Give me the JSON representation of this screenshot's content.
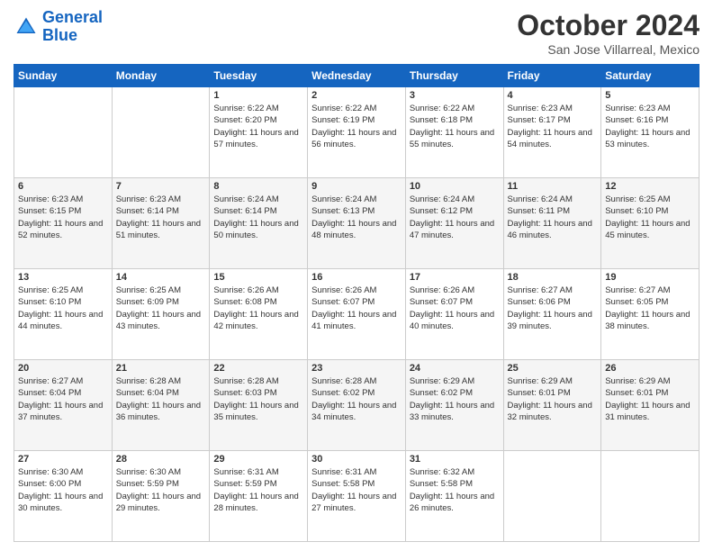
{
  "header": {
    "logo": {
      "line1": "General",
      "line2": "Blue"
    },
    "title": "October 2024",
    "location": "San Jose Villarreal, Mexico"
  },
  "days_of_week": [
    "Sunday",
    "Monday",
    "Tuesday",
    "Wednesday",
    "Thursday",
    "Friday",
    "Saturday"
  ],
  "weeks": [
    [
      {
        "day": "",
        "sunrise": "",
        "sunset": "",
        "daylight": ""
      },
      {
        "day": "",
        "sunrise": "",
        "sunset": "",
        "daylight": ""
      },
      {
        "day": "1",
        "sunrise": "Sunrise: 6:22 AM",
        "sunset": "Sunset: 6:20 PM",
        "daylight": "Daylight: 11 hours and 57 minutes."
      },
      {
        "day": "2",
        "sunrise": "Sunrise: 6:22 AM",
        "sunset": "Sunset: 6:19 PM",
        "daylight": "Daylight: 11 hours and 56 minutes."
      },
      {
        "day": "3",
        "sunrise": "Sunrise: 6:22 AM",
        "sunset": "Sunset: 6:18 PM",
        "daylight": "Daylight: 11 hours and 55 minutes."
      },
      {
        "day": "4",
        "sunrise": "Sunrise: 6:23 AM",
        "sunset": "Sunset: 6:17 PM",
        "daylight": "Daylight: 11 hours and 54 minutes."
      },
      {
        "day": "5",
        "sunrise": "Sunrise: 6:23 AM",
        "sunset": "Sunset: 6:16 PM",
        "daylight": "Daylight: 11 hours and 53 minutes."
      }
    ],
    [
      {
        "day": "6",
        "sunrise": "Sunrise: 6:23 AM",
        "sunset": "Sunset: 6:15 PM",
        "daylight": "Daylight: 11 hours and 52 minutes."
      },
      {
        "day": "7",
        "sunrise": "Sunrise: 6:23 AM",
        "sunset": "Sunset: 6:14 PM",
        "daylight": "Daylight: 11 hours and 51 minutes."
      },
      {
        "day": "8",
        "sunrise": "Sunrise: 6:24 AM",
        "sunset": "Sunset: 6:14 PM",
        "daylight": "Daylight: 11 hours and 50 minutes."
      },
      {
        "day": "9",
        "sunrise": "Sunrise: 6:24 AM",
        "sunset": "Sunset: 6:13 PM",
        "daylight": "Daylight: 11 hours and 48 minutes."
      },
      {
        "day": "10",
        "sunrise": "Sunrise: 6:24 AM",
        "sunset": "Sunset: 6:12 PM",
        "daylight": "Daylight: 11 hours and 47 minutes."
      },
      {
        "day": "11",
        "sunrise": "Sunrise: 6:24 AM",
        "sunset": "Sunset: 6:11 PM",
        "daylight": "Daylight: 11 hours and 46 minutes."
      },
      {
        "day": "12",
        "sunrise": "Sunrise: 6:25 AM",
        "sunset": "Sunset: 6:10 PM",
        "daylight": "Daylight: 11 hours and 45 minutes."
      }
    ],
    [
      {
        "day": "13",
        "sunrise": "Sunrise: 6:25 AM",
        "sunset": "Sunset: 6:10 PM",
        "daylight": "Daylight: 11 hours and 44 minutes."
      },
      {
        "day": "14",
        "sunrise": "Sunrise: 6:25 AM",
        "sunset": "Sunset: 6:09 PM",
        "daylight": "Daylight: 11 hours and 43 minutes."
      },
      {
        "day": "15",
        "sunrise": "Sunrise: 6:26 AM",
        "sunset": "Sunset: 6:08 PM",
        "daylight": "Daylight: 11 hours and 42 minutes."
      },
      {
        "day": "16",
        "sunrise": "Sunrise: 6:26 AM",
        "sunset": "Sunset: 6:07 PM",
        "daylight": "Daylight: 11 hours and 41 minutes."
      },
      {
        "day": "17",
        "sunrise": "Sunrise: 6:26 AM",
        "sunset": "Sunset: 6:07 PM",
        "daylight": "Daylight: 11 hours and 40 minutes."
      },
      {
        "day": "18",
        "sunrise": "Sunrise: 6:27 AM",
        "sunset": "Sunset: 6:06 PM",
        "daylight": "Daylight: 11 hours and 39 minutes."
      },
      {
        "day": "19",
        "sunrise": "Sunrise: 6:27 AM",
        "sunset": "Sunset: 6:05 PM",
        "daylight": "Daylight: 11 hours and 38 minutes."
      }
    ],
    [
      {
        "day": "20",
        "sunrise": "Sunrise: 6:27 AM",
        "sunset": "Sunset: 6:04 PM",
        "daylight": "Daylight: 11 hours and 37 minutes."
      },
      {
        "day": "21",
        "sunrise": "Sunrise: 6:28 AM",
        "sunset": "Sunset: 6:04 PM",
        "daylight": "Daylight: 11 hours and 36 minutes."
      },
      {
        "day": "22",
        "sunrise": "Sunrise: 6:28 AM",
        "sunset": "Sunset: 6:03 PM",
        "daylight": "Daylight: 11 hours and 35 minutes."
      },
      {
        "day": "23",
        "sunrise": "Sunrise: 6:28 AM",
        "sunset": "Sunset: 6:02 PM",
        "daylight": "Daylight: 11 hours and 34 minutes."
      },
      {
        "day": "24",
        "sunrise": "Sunrise: 6:29 AM",
        "sunset": "Sunset: 6:02 PM",
        "daylight": "Daylight: 11 hours and 33 minutes."
      },
      {
        "day": "25",
        "sunrise": "Sunrise: 6:29 AM",
        "sunset": "Sunset: 6:01 PM",
        "daylight": "Daylight: 11 hours and 32 minutes."
      },
      {
        "day": "26",
        "sunrise": "Sunrise: 6:29 AM",
        "sunset": "Sunset: 6:01 PM",
        "daylight": "Daylight: 11 hours and 31 minutes."
      }
    ],
    [
      {
        "day": "27",
        "sunrise": "Sunrise: 6:30 AM",
        "sunset": "Sunset: 6:00 PM",
        "daylight": "Daylight: 11 hours and 30 minutes."
      },
      {
        "day": "28",
        "sunrise": "Sunrise: 6:30 AM",
        "sunset": "Sunset: 5:59 PM",
        "daylight": "Daylight: 11 hours and 29 minutes."
      },
      {
        "day": "29",
        "sunrise": "Sunrise: 6:31 AM",
        "sunset": "Sunset: 5:59 PM",
        "daylight": "Daylight: 11 hours and 28 minutes."
      },
      {
        "day": "30",
        "sunrise": "Sunrise: 6:31 AM",
        "sunset": "Sunset: 5:58 PM",
        "daylight": "Daylight: 11 hours and 27 minutes."
      },
      {
        "day": "31",
        "sunrise": "Sunrise: 6:32 AM",
        "sunset": "Sunset: 5:58 PM",
        "daylight": "Daylight: 11 hours and 26 minutes."
      },
      {
        "day": "",
        "sunrise": "",
        "sunset": "",
        "daylight": ""
      },
      {
        "day": "",
        "sunrise": "",
        "sunset": "",
        "daylight": ""
      }
    ]
  ]
}
